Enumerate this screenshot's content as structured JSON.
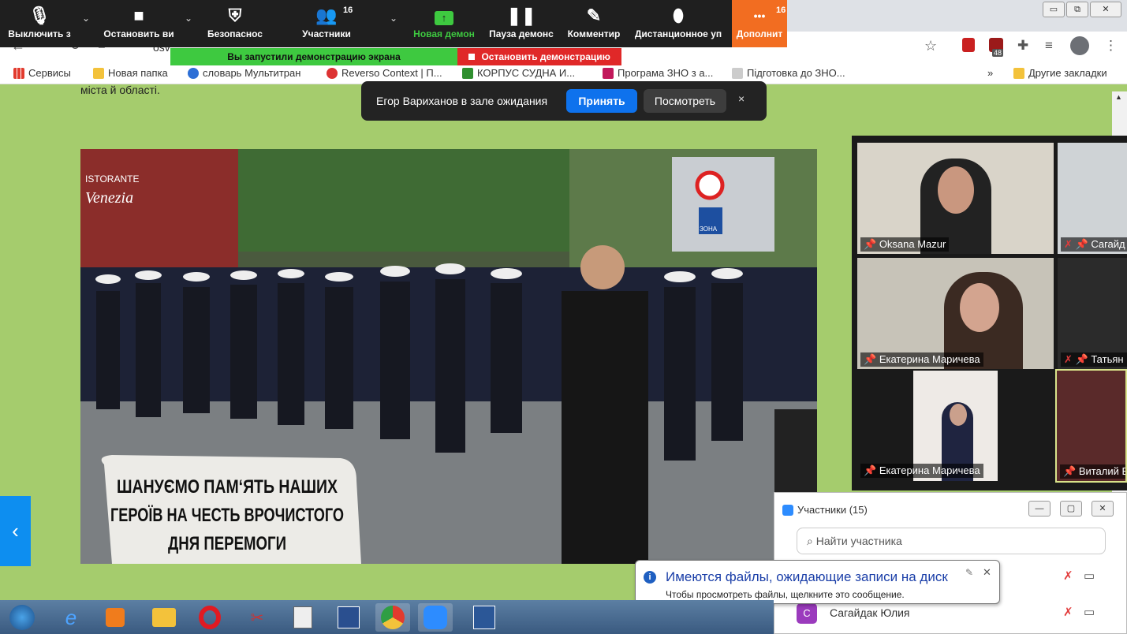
{
  "zoom_toolbar": {
    "mute_label": "Выключить з",
    "video_label": "Остановить ви",
    "security_label": "Безопаснос",
    "participants_label": "Участники",
    "participants_count": "16",
    "new_share_label": "Новая демон",
    "pause_label": "Пауза демонс",
    "annotate_label": "Комментир",
    "remote_label": "Дистанционное уп",
    "more_label": "Дополнит",
    "more_count": "16",
    "more_dots": "•••"
  },
  "share_banner": {
    "status_text": "Вы запустили демонстрацию экрана",
    "stop_text": "Остановить демонстрацию"
  },
  "browser": {
    "url_fragment": "osv",
    "extension_badge": "48",
    "bookmarks": [
      {
        "label": "Сервисы"
      },
      {
        "label": "Новая папка"
      },
      {
        "label": "словарь Мультитран"
      },
      {
        "label": "Reverso Context | П..."
      },
      {
        "label": "КОРПУС СУДНА И..."
      },
      {
        "label": "Програма ЗНО з а..."
      },
      {
        "label": "Підготовка до ЗНО..."
      }
    ],
    "bookmarks_overflow": "»",
    "other_bookmarks": "Другие закладки"
  },
  "waiting_room": {
    "message": "Егор Вариханов в зале ожидания",
    "accept_label": "Принять",
    "view_label": "Посмотреть",
    "close_label": "×"
  },
  "page": {
    "partial_text": "міста й області.",
    "video_caption_line1": "ШАНУЄМО ПАМ‘ЯТЬ НАШИХ",
    "video_caption_line2": "ГЕРОЇВ НА ЧЕСТЬ ВРОЧИСТОГО",
    "video_caption_line3": "ДНЯ ПЕРЕМОГИ",
    "sign_text1": "ISTORANTE",
    "sign_text2": "Venezia",
    "zone_sign": "ЗОНА",
    "prev_arrow": "‹"
  },
  "gallery": {
    "tiles": [
      {
        "name": "Oksana Mazur"
      },
      {
        "name": "Сагайд"
      },
      {
        "name": "Екатерина Маричева"
      },
      {
        "name": "Татьян"
      },
      {
        "name": "Екатерина Маричева"
      },
      {
        "name": "Виталий Б"
      }
    ]
  },
  "participants_panel": {
    "title": "Участники (15)",
    "search_placeholder": "Найти участника",
    "rows": [
      {
        "initial": "С",
        "name": "Сагайдак Юлия"
      }
    ]
  },
  "notification": {
    "title": "Имеются файлы, ожидающие записи на диск",
    "body": "Чтобы просмотреть файлы, щелкните это сообщение."
  },
  "colors": {
    "zoom_toolbar": "#1f1f1f",
    "share_green": "#3ec940",
    "stop_red": "#e02828",
    "accept_blue": "#0e72ed",
    "page_green": "#a5cc6d",
    "more_orange": "#f26d21"
  }
}
